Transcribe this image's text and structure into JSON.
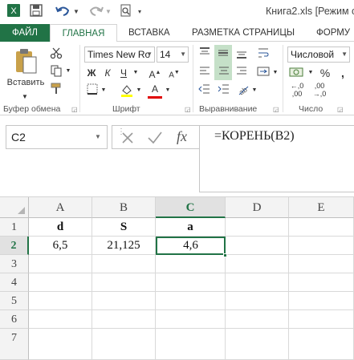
{
  "window": {
    "title": "Книга2.xls  [Режим с"
  },
  "quick_access": {
    "save_icon": "save-icon",
    "undo_icon": "undo-icon",
    "redo_icon": "redo-icon",
    "preview_icon": "print-preview-icon",
    "customize_icon": "chevron-down-icon"
  },
  "tabs": [
    {
      "label": "ФАЙЛ"
    },
    {
      "label": "ГЛАВНАЯ"
    },
    {
      "label": "ВСТАВКА"
    },
    {
      "label": "РАЗМЕТКА СТРАНИЦЫ"
    },
    {
      "label": "ФОРМУ"
    }
  ],
  "ribbon": {
    "clipboard": {
      "paste_label": "Вставить",
      "group_label": "Буфер обмена"
    },
    "font": {
      "font_name": "Times New Ro",
      "font_size": "14",
      "bold": "Ж",
      "italic": "К",
      "underline": "Ч",
      "font_color_glyph": "А",
      "group_label": "Шрифт"
    },
    "alignment": {
      "group_label": "Выравнивание"
    },
    "number": {
      "format": "Числовой",
      "percent": "%",
      "group_label": "Число",
      "decrease_decimal": ",00",
      "increase_decimal": ",0"
    }
  },
  "formula_bar": {
    "name_box": "C2",
    "cancel_icon": "cancel-icon",
    "enter_icon": "check-icon",
    "fx_label": "fx",
    "formula": "=КОРЕНЬ(B2)"
  },
  "sheet": {
    "columns": [
      "A",
      "B",
      "C",
      "D",
      "E"
    ],
    "rows": [
      "1",
      "2",
      "3",
      "4",
      "5",
      "6",
      "7"
    ],
    "cells": {
      "A1": "d",
      "B1": "S",
      "C1": "a",
      "A2": "6,5",
      "B2": "21,125",
      "C2": "4,6"
    },
    "active_cell": "C2",
    "accent": "#217346"
  }
}
